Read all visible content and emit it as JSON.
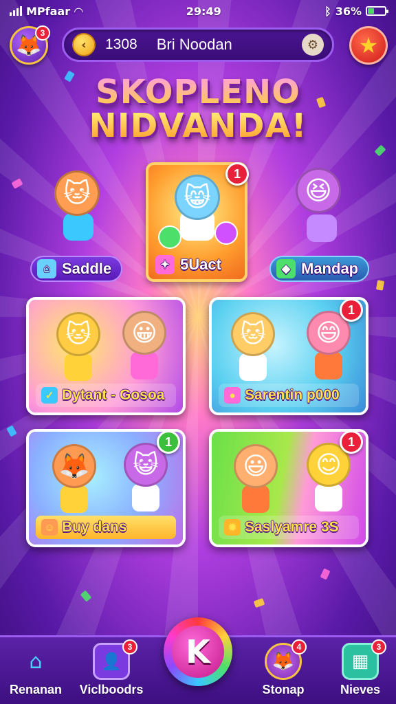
{
  "status_bar": {
    "carrier": "MPfaar",
    "time": "29:49",
    "battery_percent": "36%",
    "battery_level": 0.36
  },
  "header": {
    "avatar_badge": "3",
    "coin_count": "1308",
    "player_name": "Bri Noodan"
  },
  "title": {
    "line1": "SKOPLENO",
    "line2": "NIDVANDA!"
  },
  "featured": [
    {
      "label": "Saddle",
      "icon": "house-icon"
    },
    {
      "label": "5Uact",
      "icon": "puzzle-icon",
      "badge": "1"
    },
    {
      "label": "Mandap",
      "icon": "gem-icon"
    }
  ],
  "game_cards": [
    {
      "label": "Dytant - Gosoa",
      "badge": ""
    },
    {
      "label": "Sarentin p000",
      "badge": "1"
    },
    {
      "label": "Buy dans",
      "badge": "1"
    },
    {
      "label": "Saslyamre 3S",
      "badge": "1"
    }
  ],
  "bottom_nav": [
    {
      "label": "Renanan",
      "icon": "home-icon",
      "badge": ""
    },
    {
      "label": "Viclboodrs",
      "icon": "profile-icon",
      "badge": "3"
    },
    {
      "label": "K",
      "icon": "play-icon",
      "badge": ""
    },
    {
      "label": "Stonap",
      "icon": "pet-icon",
      "badge": "4"
    },
    {
      "label": "Nieves",
      "icon": "grid-icon",
      "badge": "3"
    }
  ],
  "colors": {
    "accent": "#ffe23a",
    "badge_red": "#e8203a",
    "badge_green": "#3cbf3c",
    "nav_bg": "#4a1890"
  }
}
